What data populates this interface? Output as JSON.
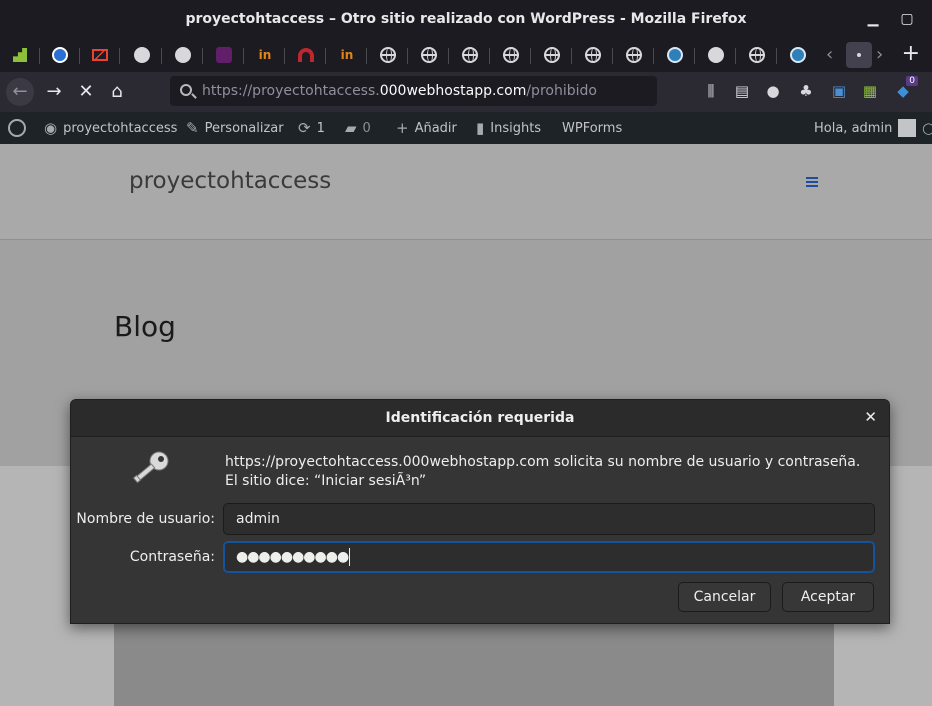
{
  "window": {
    "title": "proyectohtaccess – Otro sitio realizado con WordPress - Mozilla Firefox"
  },
  "urlbar": {
    "prefix": "https://proyectohtaccess.",
    "host": "000webhostapp.com",
    "path": "/prohibido"
  },
  "extensions": {
    "badge_count": "0"
  },
  "adminbar": {
    "site_name": "proyectohtaccess",
    "customize": "Personalizar",
    "updates_count": "1",
    "comments_count": "0",
    "add_new": "Añadir",
    "insights": "Insights",
    "wpforms": "WPForms",
    "greeting": "Hola, admin"
  },
  "site": {
    "title": "proyectohtaccess",
    "page_title": "Blog"
  },
  "dialog": {
    "title": "Identificación requerida",
    "message": "https://proyectohtaccess.000webhostapp.com solicita su nombre de usuario y contraseña. El sitio dice: “Iniciar sesiÃ³n”",
    "username_label": "Nombre de usuario:",
    "username_value": "admin",
    "password_label": "Contraseña:",
    "password_value": "●●●●●●●●●●",
    "cancel_label": "Cancelar",
    "accept_label": "Aceptar"
  },
  "colors": {
    "wp_accent": "#2f7fb8",
    "focus_ring": "#15539e",
    "menu_icon": "#1f4f9a"
  }
}
